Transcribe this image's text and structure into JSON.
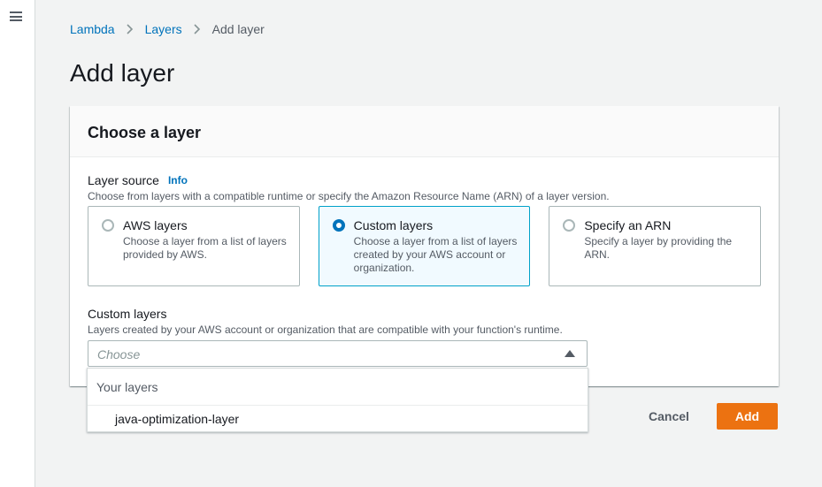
{
  "breadcrumb": {
    "items": [
      "Lambda",
      "Layers"
    ],
    "current": "Add layer"
  },
  "page_title": "Add layer",
  "panel": {
    "title": "Choose a layer",
    "layer_source": {
      "label": "Layer source",
      "info": "Info",
      "description": "Choose from layers with a compatible runtime or specify the Amazon Resource Name (ARN) of a layer version.",
      "options": [
        {
          "title": "AWS layers",
          "desc": "Choose a layer from a list of layers provided by AWS.",
          "selected": false
        },
        {
          "title": "Custom layers",
          "desc": "Choose a layer from a list of layers created by your AWS account or organization.",
          "selected": true
        },
        {
          "title": "Specify an ARN",
          "desc": "Specify a layer by providing the ARN.",
          "selected": false
        }
      ]
    },
    "custom_layers": {
      "label": "Custom layers",
      "description": "Layers created by your AWS account or organization that are compatible with your function's runtime.",
      "placeholder": "Choose"
    }
  },
  "dropdown": {
    "group_label": "Your layers",
    "options": [
      "java-optimization-layer"
    ]
  },
  "actions": {
    "cancel": "Cancel",
    "add": "Add"
  },
  "colors": {
    "link": "#0073bb",
    "primary_button": "#ec7211",
    "selected_tile_border": "#00a1c9",
    "selected_tile_bg": "#f1faff"
  }
}
